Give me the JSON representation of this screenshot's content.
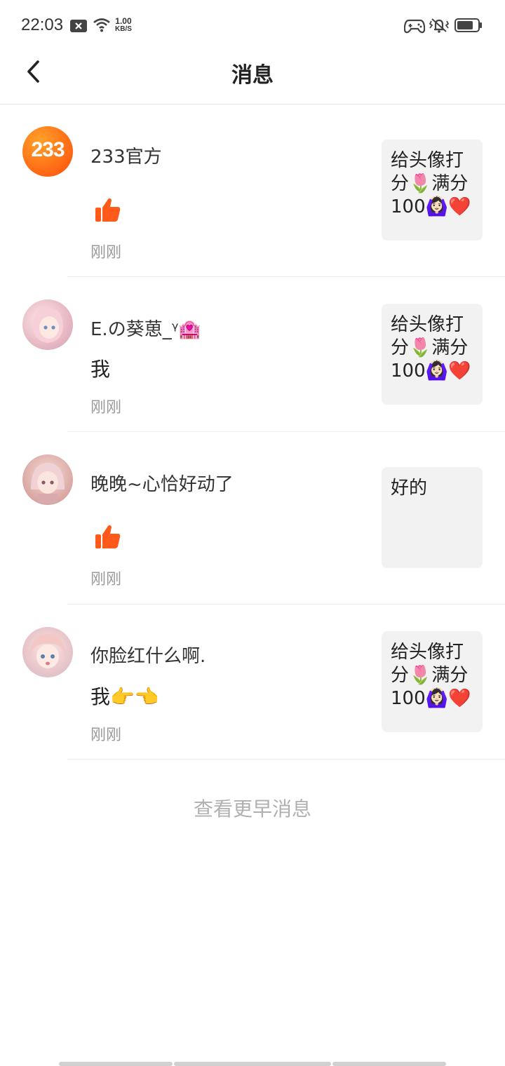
{
  "status_bar": {
    "time": "22:03",
    "net_speed_value": "1.00",
    "net_speed_unit": "KB/S",
    "icons": [
      "notification-x-icon",
      "wifi-icon",
      "gamepad-icon",
      "vibrate-icon",
      "battery-icon"
    ]
  },
  "header": {
    "back_icon": "chevron-left-icon",
    "title": "消息"
  },
  "messages": [
    {
      "avatar_text": "233",
      "avatar_colors": [
        "#ff8a00",
        "#ff3d00"
      ],
      "sender": "233官方",
      "content_type": "like",
      "body": "",
      "time": "刚刚",
      "quote": "给头像打分🌷满分100🙆🏻‍♀️❤️"
    },
    {
      "avatar_colors": [
        "#f7d5d5",
        "#e9b9c4"
      ],
      "sender": "E.の葵葸_ᵞ🏩",
      "content_type": "text",
      "body": "我",
      "time": "刚刚",
      "quote": "给头像打分🌷满分100🙆🏻‍♀️❤️"
    },
    {
      "avatar_colors": [
        "#f1c9c2",
        "#d9a2a2"
      ],
      "sender": "晚晚~心恰好动了",
      "content_type": "like",
      "body": "",
      "time": "刚刚",
      "quote": "好的"
    },
    {
      "avatar_colors": [
        "#f4dada",
        "#c9c8d8"
      ],
      "sender": "你脸红什么啊.",
      "content_type": "text",
      "body": "我👉👈",
      "time": "刚刚",
      "quote": "给头像打分🌷满分100🙆🏻‍♀️❤️"
    }
  ],
  "footer": {
    "more_label": "查看更早消息"
  },
  "colors": {
    "accent": "#ff6a1a",
    "divider": "#ececec",
    "quote_bg": "#f2f2f2"
  }
}
